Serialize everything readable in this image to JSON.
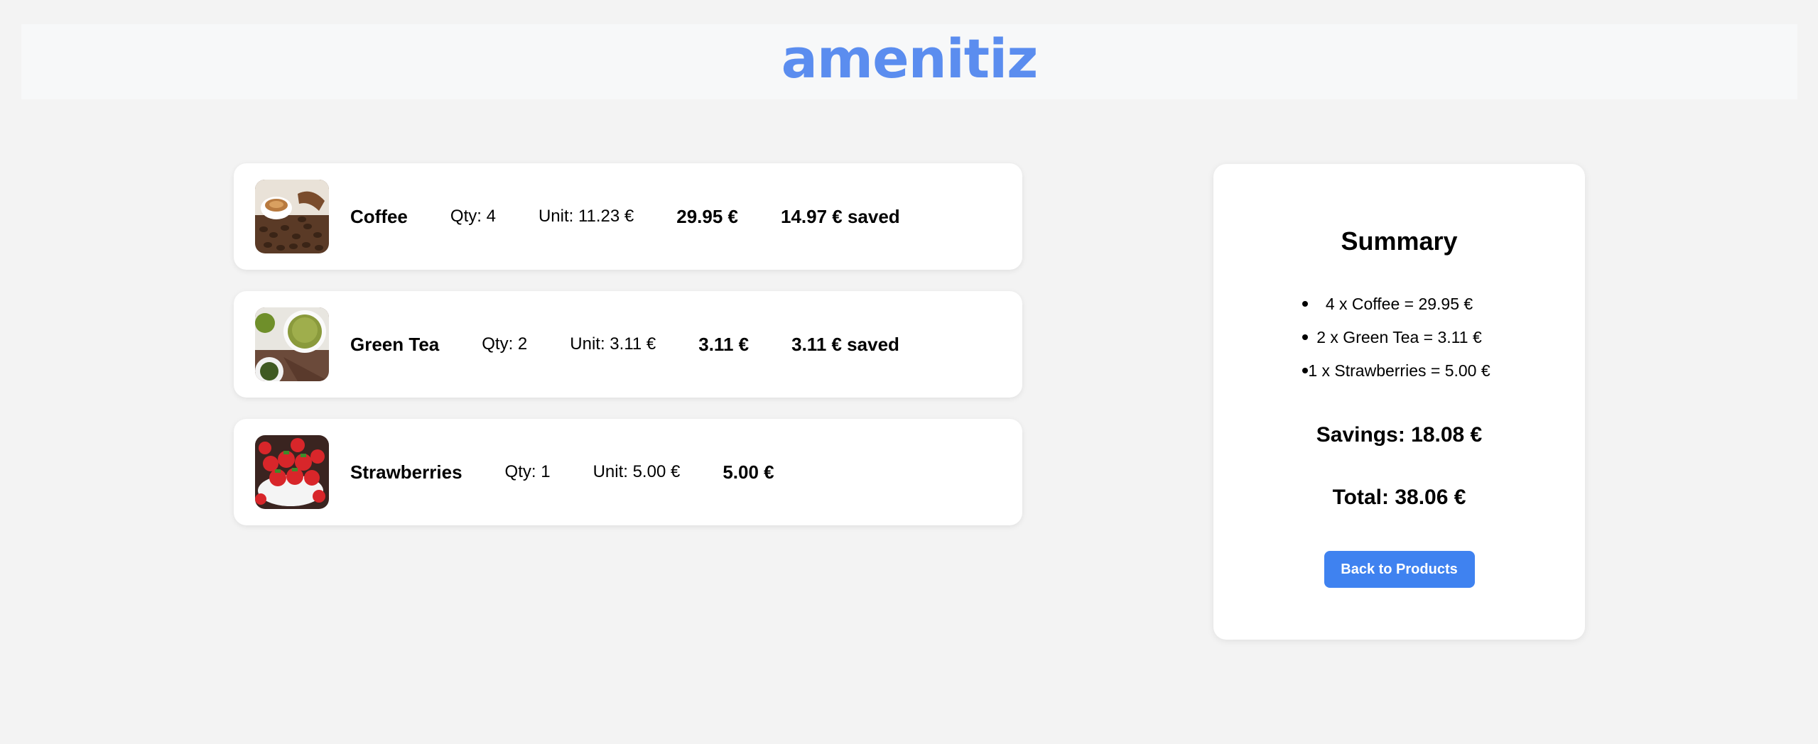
{
  "header": {
    "logo_text": "amenitiz"
  },
  "cart": {
    "items": [
      {
        "name": "Coffee",
        "qty": "Qty: 4",
        "unit": "Unit: 11.23 €",
        "price": "29.95 €",
        "saved": "14.97 € saved",
        "icon": "coffee-image"
      },
      {
        "name": "Green Tea",
        "qty": "Qty: 2",
        "unit": "Unit: 3.11 €",
        "price": "3.11 €",
        "saved": "3.11 € saved",
        "icon": "green-tea-image"
      },
      {
        "name": "Strawberries",
        "qty": "Qty: 1",
        "unit": "Unit: 5.00 €",
        "price": "5.00 €",
        "saved": "",
        "icon": "strawberries-image"
      }
    ]
  },
  "summary": {
    "title": "Summary",
    "lines": [
      "4 x Coffee = 29.95 €",
      "2 x Green Tea = 3.11 €",
      "1 x Strawberries = 5.00 €"
    ],
    "savings": "Savings: 18.08 €",
    "total": "Total: 38.06 €",
    "back_button": "Back to Products"
  },
  "colors": {
    "brand": "#5b8def",
    "button": "#3f82f0",
    "background": "#f3f3f3"
  }
}
